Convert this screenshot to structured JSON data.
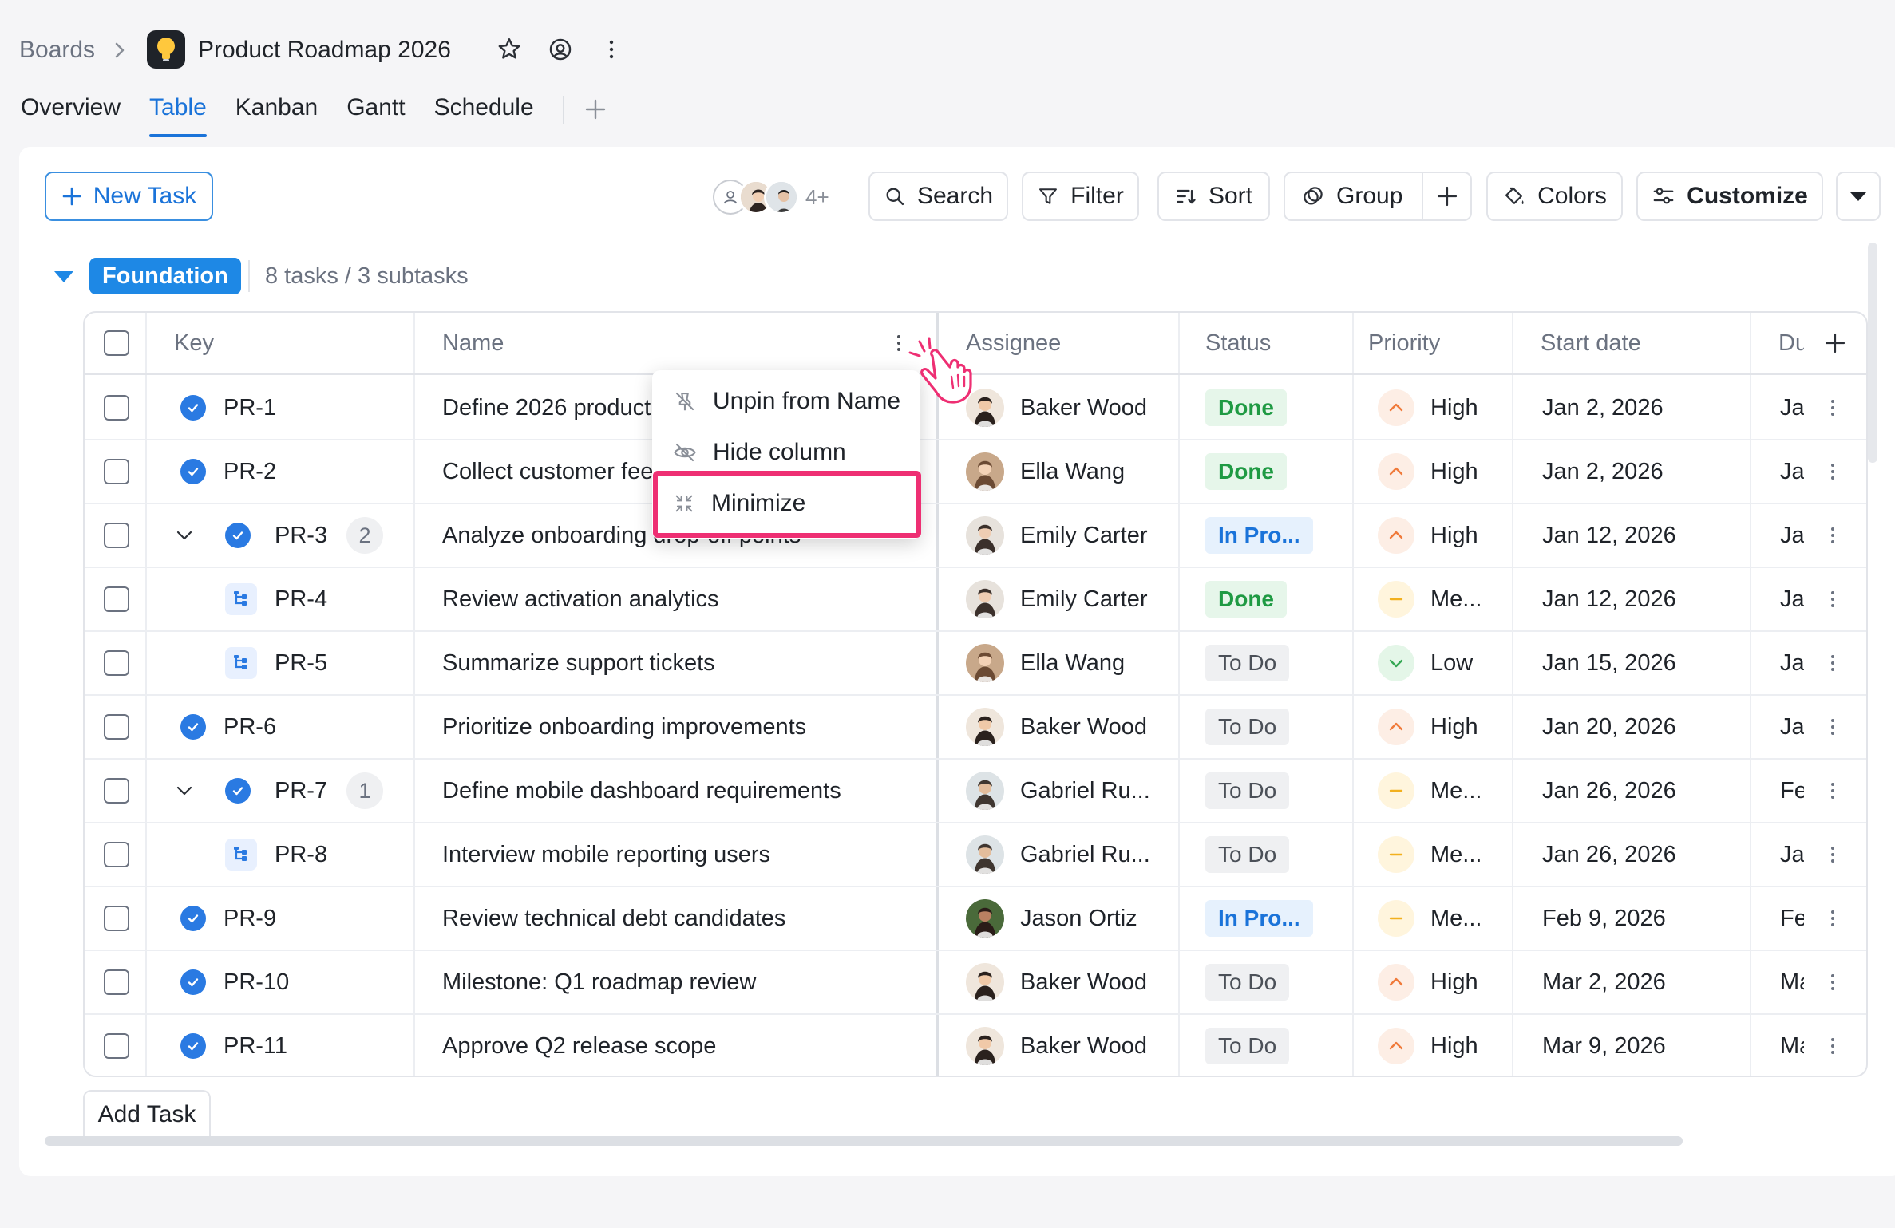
{
  "breadcrumb": {
    "boards": "Boards",
    "title": "Product Roadmap 2026"
  },
  "tabs": [
    {
      "label": "Overview"
    },
    {
      "label": "Table",
      "active": true
    },
    {
      "label": "Kanban"
    },
    {
      "label": "Gantt"
    },
    {
      "label": "Schedule"
    }
  ],
  "toolbar": {
    "new_task": "New Task",
    "members_more": "4+",
    "search": "Search",
    "filter": "Filter",
    "sort": "Sort",
    "group": "Group",
    "colors": "Colors",
    "customize": "Customize"
  },
  "group": {
    "name": "Foundation",
    "count": "8 tasks / 3 subtasks"
  },
  "columns": {
    "key": "Key",
    "name": "Name",
    "assignee": "Assignee",
    "status": "Status",
    "priority": "Priority",
    "start_date": "Start date",
    "due": "Du"
  },
  "rows": [
    {
      "key": "PR-1",
      "type": "task",
      "name": "Define 2026 product",
      "assignee": "Baker Wood",
      "status": "Done",
      "priority": "High",
      "start": "Jan 2, 2026",
      "due": "Jar"
    },
    {
      "key": "PR-2",
      "type": "task",
      "name": "Collect customer fee",
      "assignee": "Ella Wang",
      "status": "Done",
      "priority": "High",
      "start": "Jan 2, 2026",
      "due": "Jar"
    },
    {
      "key": "PR-3",
      "type": "parent",
      "subtasks": "2",
      "name": "Analyze onboarding drop-off points",
      "assignee": "Emily Carter",
      "status": "In Pro...",
      "priority": "High",
      "start": "Jan 12, 2026",
      "due": "Jar"
    },
    {
      "key": "PR-4",
      "type": "subtask",
      "name": "Review activation analytics",
      "assignee": "Emily Carter",
      "status": "Done",
      "priority": "Me...",
      "start": "Jan 12, 2026",
      "due": "Jar"
    },
    {
      "key": "PR-5",
      "type": "subtask",
      "name": "Summarize support tickets",
      "assignee": "Ella Wang",
      "status": "To Do",
      "priority": "Low",
      "start": "Jan 15, 2026",
      "due": "Jar"
    },
    {
      "key": "PR-6",
      "type": "task",
      "name": "Prioritize onboarding improvements",
      "assignee": "Baker Wood",
      "status": "To Do",
      "priority": "High",
      "start": "Jan 20, 2026",
      "due": "Jar"
    },
    {
      "key": "PR-7",
      "type": "parent",
      "subtasks": "1",
      "name": "Define mobile dashboard requirements",
      "assignee": "Gabriel Ru...",
      "status": "To Do",
      "priority": "Me...",
      "start": "Jan 26, 2026",
      "due": "Fe"
    },
    {
      "key": "PR-8",
      "type": "subtask",
      "name": "Interview mobile reporting users",
      "assignee": "Gabriel Ru...",
      "status": "To Do",
      "priority": "Me...",
      "start": "Jan 26, 2026",
      "due": "Jar"
    },
    {
      "key": "PR-9",
      "type": "task",
      "name": "Review technical debt candidates",
      "assignee": "Jason Ortiz",
      "status": "In Pro...",
      "priority": "Me...",
      "start": "Feb 9, 2026",
      "due": "Fe"
    },
    {
      "key": "PR-10",
      "type": "task",
      "name": "Milestone: Q1 roadmap review",
      "assignee": "Baker Wood",
      "status": "To Do",
      "priority": "High",
      "start": "Mar 2, 2026",
      "due": "Ma"
    },
    {
      "key": "PR-11",
      "type": "task",
      "name": "Approve Q2 release scope",
      "assignee": "Baker Wood",
      "status": "To Do",
      "priority": "High",
      "start": "Mar 9, 2026",
      "due": "Ma"
    }
  ],
  "context_menu": {
    "unpin": "Unpin from Name",
    "hide": "Hide column",
    "minimize": "Minimize"
  },
  "add_task": "Add Task",
  "colors": {
    "accent": "#1a73d9",
    "group_pill": "#1e88e5",
    "highlight": "#ee2f73",
    "done": "#1f9a43",
    "high": "#f07a3a",
    "medium": "#f2b01e",
    "low": "#34a853"
  }
}
